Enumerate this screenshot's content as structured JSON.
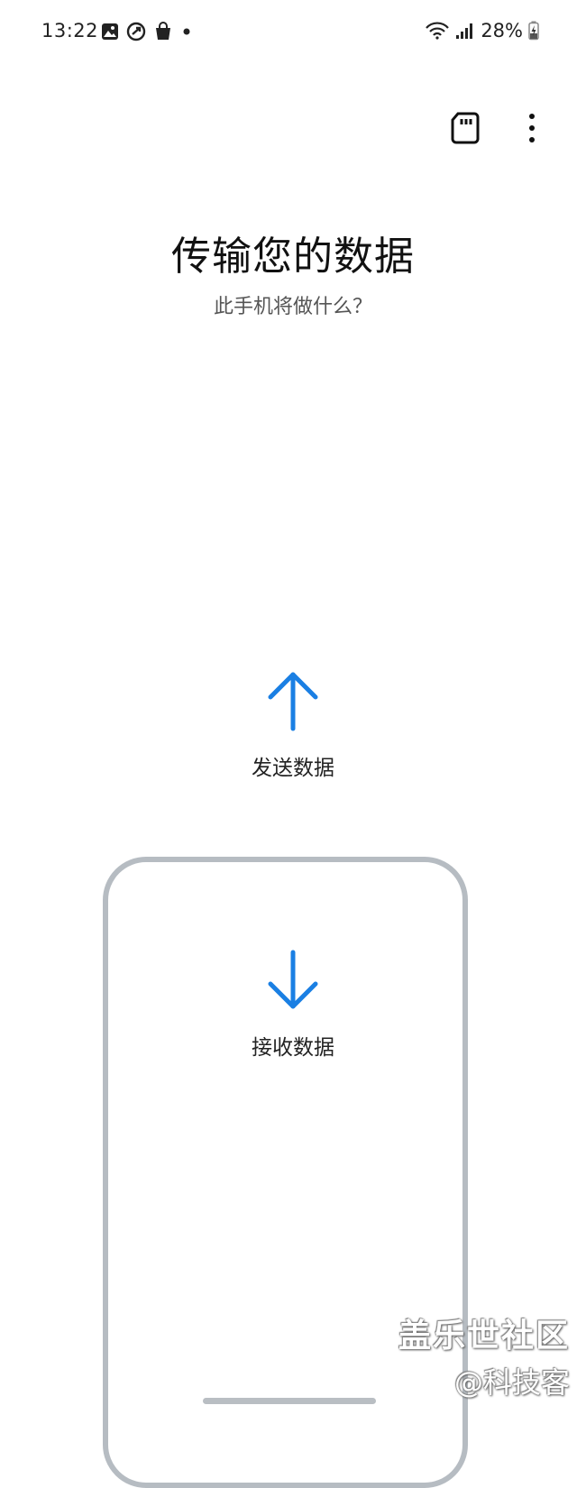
{
  "status_bar": {
    "time": "13:22",
    "battery": "28%",
    "left_icons": [
      "gallery-icon",
      "sync-icon",
      "shopping-bag-icon",
      "notification-dot-icon"
    ],
    "right_icons": [
      "wifi-icon",
      "signal-icon",
      "battery-charging-icon"
    ]
  },
  "toolbar": {
    "icons": [
      "sd-card-icon",
      "more-options-icon"
    ]
  },
  "main": {
    "title": "传输您的数据",
    "subtitle": "此手机将做什么？"
  },
  "options": {
    "send_label": "发送数据",
    "receive_label": "接收数据"
  },
  "watermark": {
    "line1": "盖乐世社区",
    "line2": "@科技客"
  },
  "colors": {
    "accent": "#1a7fe3",
    "outline": "#b6bcc2"
  }
}
